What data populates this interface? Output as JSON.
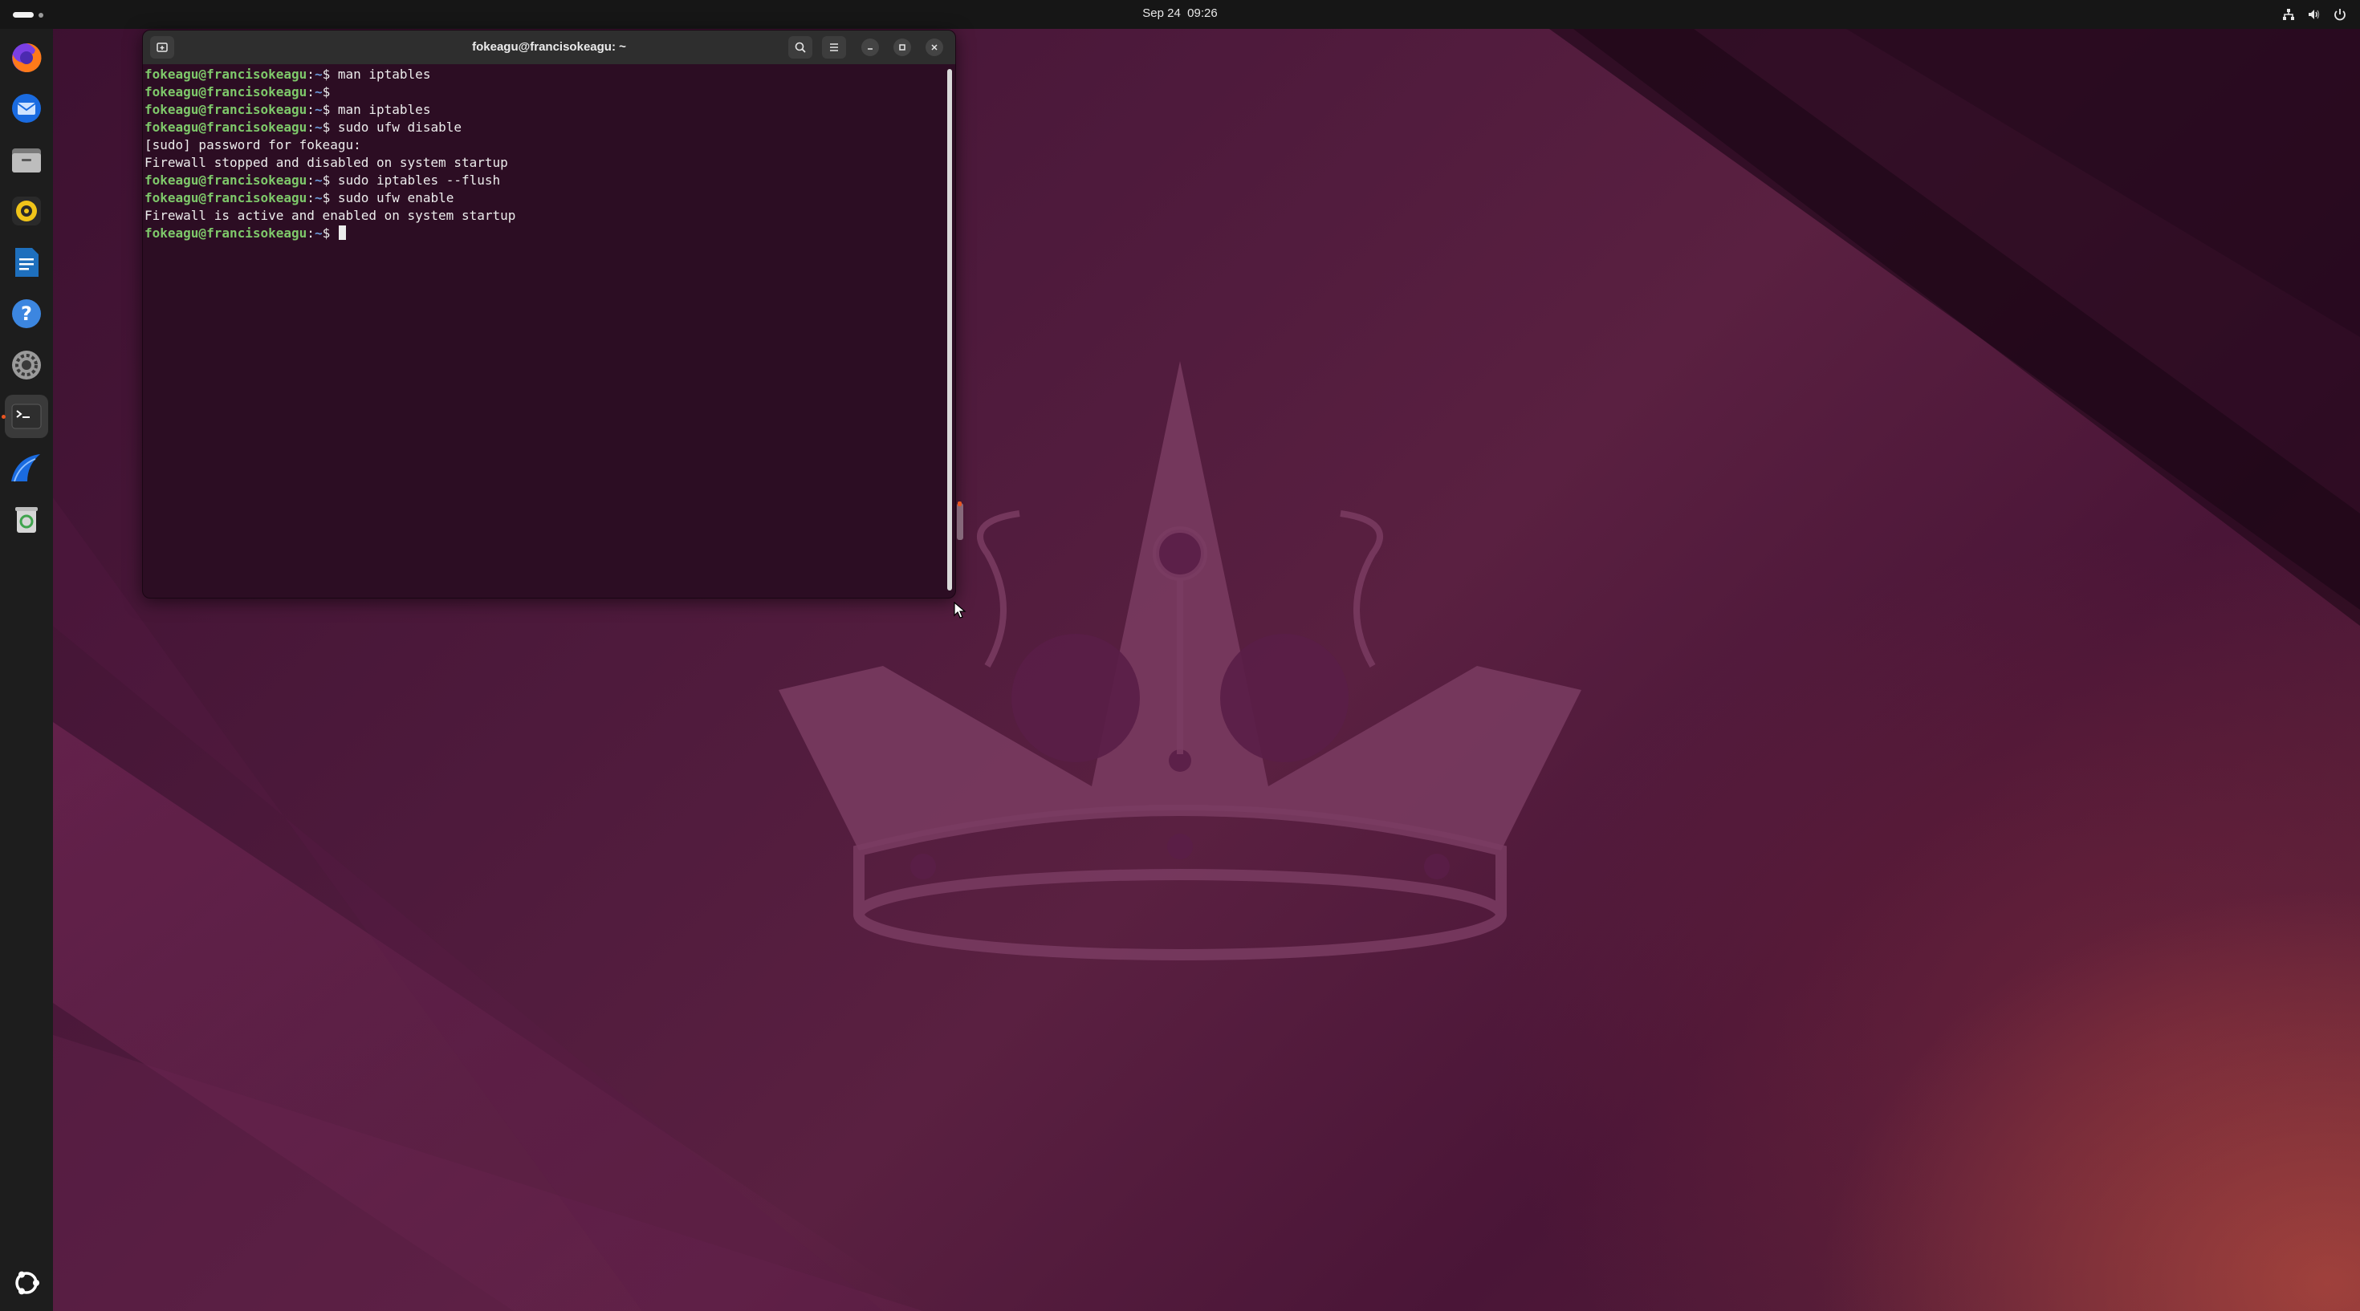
{
  "topbar": {
    "date": "Sep 24",
    "time": "09:26",
    "tray_icons": [
      "network-icon",
      "volume-icon",
      "power-icon"
    ]
  },
  "dock": {
    "items": [
      {
        "name": "firefox",
        "icon": "firefox-icon",
        "running": false
      },
      {
        "name": "thunderbird",
        "icon": "thunderbird-icon",
        "running": false
      },
      {
        "name": "files",
        "icon": "files-icon",
        "running": false
      },
      {
        "name": "rhythmbox",
        "icon": "rhythmbox-icon",
        "running": false
      },
      {
        "name": "libreoffice-writer",
        "icon": "writer-icon",
        "running": false
      },
      {
        "name": "help",
        "icon": "help-icon",
        "running": false
      },
      {
        "name": "settings",
        "icon": "settings-icon",
        "running": false
      },
      {
        "name": "terminal",
        "icon": "terminal-icon",
        "running": true
      },
      {
        "name": "wireshark",
        "icon": "wireshark-icon",
        "running": false
      },
      {
        "name": "trash",
        "icon": "trash-icon",
        "running": false
      }
    ],
    "show_apps_icon": "ubuntu-apps-icon"
  },
  "terminal": {
    "title": "fokeagu@francisokeagu: ~",
    "prompt": {
      "user_host": "fokeagu@francisokeagu",
      "colon": ":",
      "path": "~",
      "symbol": "$"
    },
    "lines": [
      {
        "type": "cmd",
        "text": " man iptables"
      },
      {
        "type": "cmd",
        "text": ""
      },
      {
        "type": "cmd",
        "text": " man iptables"
      },
      {
        "type": "cmd",
        "text": " sudo ufw disable"
      },
      {
        "type": "out",
        "text": "[sudo] password for fokeagu:"
      },
      {
        "type": "out",
        "text": "Firewall stopped and disabled on system startup"
      },
      {
        "type": "cmd",
        "text": " sudo iptables --flush"
      },
      {
        "type": "cmd",
        "text": " sudo ufw enable"
      },
      {
        "type": "out",
        "text": "Firewall is active and enabled on system startup"
      },
      {
        "type": "cmd",
        "text": " ",
        "cursor": true
      }
    ],
    "buttons": {
      "new_tab_icon": "new-tab-icon",
      "search_icon": "search-icon",
      "menu_icon": "hamburger-menu-icon",
      "minimize_icon": "minimize-icon",
      "maximize_icon": "maximize-icon",
      "close_icon": "close-icon"
    }
  },
  "colors": {
    "accent": "#e95420",
    "terminal_bg": "#2c0d23",
    "prompt_user": "#7ec86a",
    "prompt_path": "#6a97d6"
  }
}
